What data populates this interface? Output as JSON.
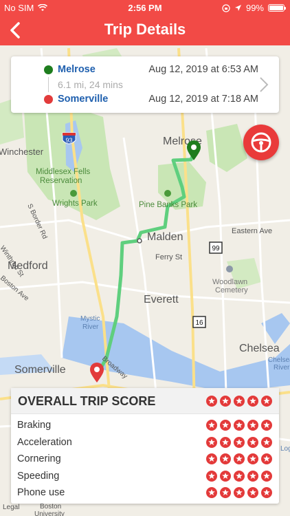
{
  "status_bar": {
    "carrier": "No SIM",
    "time": "2:56 PM",
    "battery": "99%",
    "battery_level": 0.99
  },
  "nav": {
    "title": "Trip Details",
    "back_icon": "chevron-left-icon"
  },
  "trip": {
    "start_place": "Melrose",
    "start_time": "Aug 12, 2019 at 6:53 AM",
    "summary": "6.1 mi, 24 mins",
    "end_place": "Somerville",
    "end_time": "Aug 12, 2019 at 7:18 AM",
    "start_color": "#1e7d1e",
    "end_color": "#e23b3b"
  },
  "map_labels": {
    "melrose": "Melrose",
    "winchester": "Winchester",
    "middlesex": "Middlesex Fells",
    "reservation": "Reservation",
    "wrights": "Wrights Park",
    "pine_banks": "Pine Banks Park",
    "malden": "Malden",
    "eastern_ave": "Eastern Ave",
    "medford": "Medford",
    "ferry_st": "Ferry St",
    "woodlawn": "Woodlawn",
    "cemetery": "Cemetery",
    "everett": "Everett",
    "mystic": "Mystic",
    "river": "River",
    "chelsea": "Chelsea",
    "chelsea_river": "Chelsea",
    "chelsea_river2": "River",
    "somerville": "Somerville",
    "broadway": "Broadway",
    "s_border": "S Border Rd",
    "boston_ave": "Boston Ave",
    "winthrop": "Winthrop St",
    "shield_93": "93",
    "shield_99": "99",
    "shield_16": "16",
    "boston": "Boston",
    "university": "University",
    "legal": "Legal",
    "log": "Log"
  },
  "score": {
    "title": "OVERALL TRIP SCORE",
    "overall_stars": 5,
    "max_stars": 5,
    "star_color": "#e33a3a",
    "rows": [
      {
        "label": "Braking",
        "stars": 5
      },
      {
        "label": "Acceleration",
        "stars": 5
      },
      {
        "label": "Cornering",
        "stars": 5
      },
      {
        "label": "Speeding",
        "stars": 5
      },
      {
        "label": "Phone use",
        "stars": 5
      }
    ]
  },
  "colors": {
    "brand": "#f24a46",
    "route": "#5fcf7e"
  }
}
